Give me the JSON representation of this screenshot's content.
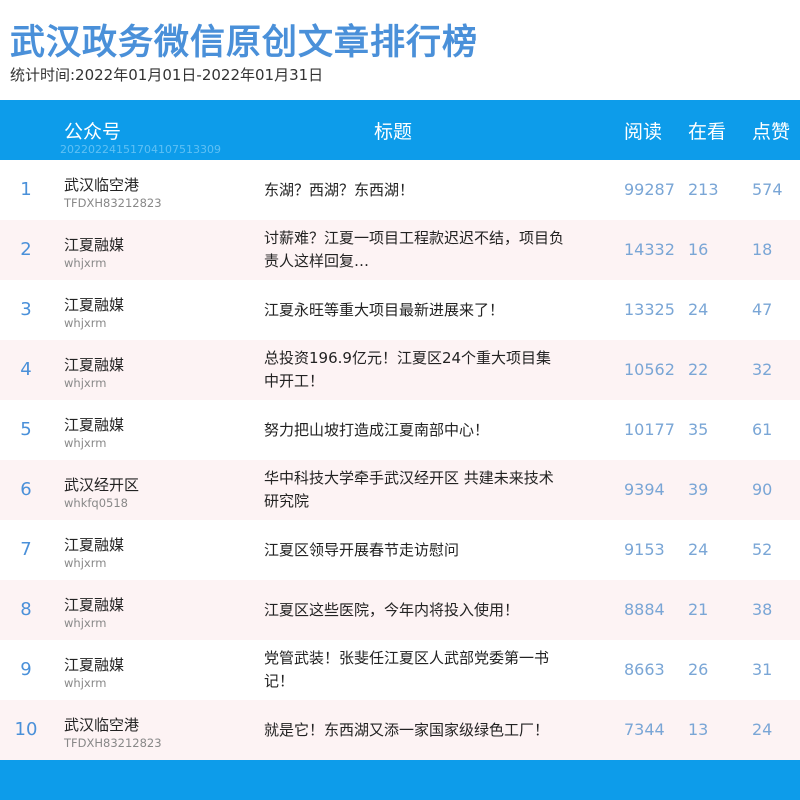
{
  "page": {
    "title": "武汉政务微信原创文章排行榜",
    "period": "统计时间:2022年01月01日-2022年01月31日"
  },
  "header": {
    "account": "公众号",
    "title": "标题",
    "read": "阅读",
    "watch": "在看",
    "like": "点赞",
    "stamp": "20220224151704107513309"
  },
  "rows": [
    {
      "rank": "1",
      "account": "武汉临空港",
      "account_id": "TFDXH83212823",
      "title": "东湖？西湖？东西湖！",
      "read": "99287",
      "watch": "213",
      "like": "574"
    },
    {
      "rank": "2",
      "account": "江夏融媒",
      "account_id": "whjxrm",
      "title": "讨薪难？江夏一项目工程款迟迟不结，项目负责人这样回复…",
      "read": "14332",
      "watch": "16",
      "like": "18"
    },
    {
      "rank": "3",
      "account": "江夏融媒",
      "account_id": "whjxrm",
      "title": "江夏永旺等重大项目最新进展来了！",
      "read": "13325",
      "watch": "24",
      "like": "47"
    },
    {
      "rank": "4",
      "account": "江夏融媒",
      "account_id": "whjxrm",
      "title": "总投资196.9亿元！江夏区24个重大项目集中开工！",
      "read": "10562",
      "watch": "22",
      "like": "32"
    },
    {
      "rank": "5",
      "account": "江夏融媒",
      "account_id": "whjxrm",
      "title": "努力把山坡打造成江夏南部中心！",
      "read": "10177",
      "watch": "35",
      "like": "61"
    },
    {
      "rank": "6",
      "account": "武汉经开区",
      "account_id": "whkfq0518",
      "title": "华中科技大学牵手武汉经开区  共建未来技术研究院",
      "read": "9394",
      "watch": "39",
      "like": "90"
    },
    {
      "rank": "7",
      "account": "江夏融媒",
      "account_id": "whjxrm",
      "title": "江夏区领导开展春节走访慰问",
      "read": "9153",
      "watch": "24",
      "like": "52"
    },
    {
      "rank": "8",
      "account": "江夏融媒",
      "account_id": "whjxrm",
      "title": "江夏区这些医院，今年内将投入使用！",
      "read": "8884",
      "watch": "21",
      "like": "38"
    },
    {
      "rank": "9",
      "account": "江夏融媒",
      "account_id": "whjxrm",
      "title": "党管武装！张斐任江夏区人武部党委第一书记！",
      "read": "8663",
      "watch": "26",
      "like": "31"
    },
    {
      "rank": "10",
      "account": "武汉临空港",
      "account_id": "TFDXH83212823",
      "title": "就是它！东西湖又添一家国家级绿色工厂！",
      "read": "7344",
      "watch": "13",
      "like": "24"
    }
  ],
  "colors": {
    "title": "#4a90d9",
    "header_bg": "#0d9cea",
    "alt_row_bg": "#fdf3f4",
    "numbers": "#7aa6d6"
  }
}
